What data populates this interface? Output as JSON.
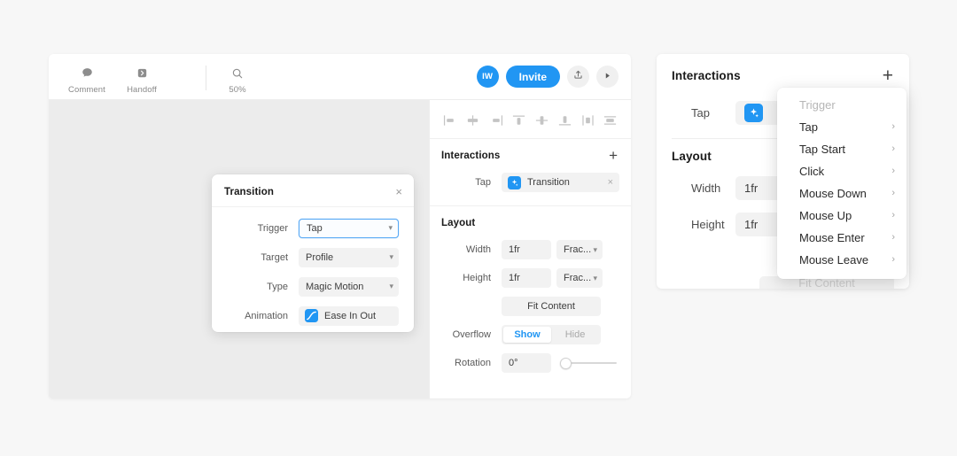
{
  "editor": {
    "toolbar": {
      "tools": [
        {
          "label": "Comment",
          "icon": "comment-icon"
        },
        {
          "label": "Handoff",
          "icon": "handoff-icon"
        }
      ],
      "zoom": {
        "label": "50%",
        "icon": "search-icon"
      },
      "avatar_initials": "IW",
      "invite_label": "Invite",
      "share_icon": "upload-share-icon",
      "play_icon": "play-icon"
    },
    "align_icons": [
      "align-left-icon",
      "align-center-horizontal-icon",
      "align-right-icon",
      "align-top-icon",
      "align-middle-vertical-icon",
      "align-bottom-icon",
      "distribute-horizontal-icon",
      "distribute-vertical-icon"
    ],
    "interactions": {
      "title": "Interactions",
      "add_label": "+",
      "rows": [
        {
          "trigger": "Tap",
          "action": "Transition",
          "remove_label": "×"
        }
      ]
    },
    "layout": {
      "title": "Layout",
      "width_label": "Width",
      "width_value": "1fr",
      "width_unit": "Frac...",
      "height_label": "Height",
      "height_value": "1fr",
      "height_unit": "Frac...",
      "fit_content_label": "Fit Content",
      "overflow_label": "Overflow",
      "overflow_options": [
        "Show",
        "Hide"
      ],
      "overflow_selected": "Show",
      "rotation_label": "Rotation",
      "rotation_value": "0°"
    }
  },
  "transition_panel": {
    "title": "Transition",
    "close_label": "×",
    "rows": [
      {
        "label": "Trigger",
        "value": "Tap",
        "focused": true
      },
      {
        "label": "Target",
        "value": "Profile",
        "focused": false
      },
      {
        "label": "Type",
        "value": "Magic Motion",
        "focused": false
      }
    ],
    "animation_label": "Animation",
    "animation_value": "Ease In Out",
    "animation_icon": "easing-curve-icon"
  },
  "right_panel": {
    "interactions": {
      "title": "Interactions",
      "add_label": "+",
      "rows": [
        {
          "trigger": "Tap"
        }
      ]
    },
    "layout": {
      "title": "Layout",
      "width_label": "Width",
      "width_value": "1fr",
      "height_label": "Height",
      "height_value": "1fr",
      "fit_content_label": "Fit Content"
    }
  },
  "trigger_menu": {
    "header": "Trigger",
    "items": [
      {
        "label": "Tap"
      },
      {
        "label": "Tap Start"
      },
      {
        "label": "Click"
      },
      {
        "label": "Mouse Down"
      },
      {
        "label": "Mouse Up"
      },
      {
        "label": "Mouse Enter"
      },
      {
        "label": "Mouse Leave"
      }
    ],
    "chevron": "›"
  },
  "colors": {
    "accent": "#2196f3",
    "canvas": "#ececec",
    "page_background": "#f7f7f7",
    "panel": "#ffffff",
    "field": "#f2f2f2"
  }
}
